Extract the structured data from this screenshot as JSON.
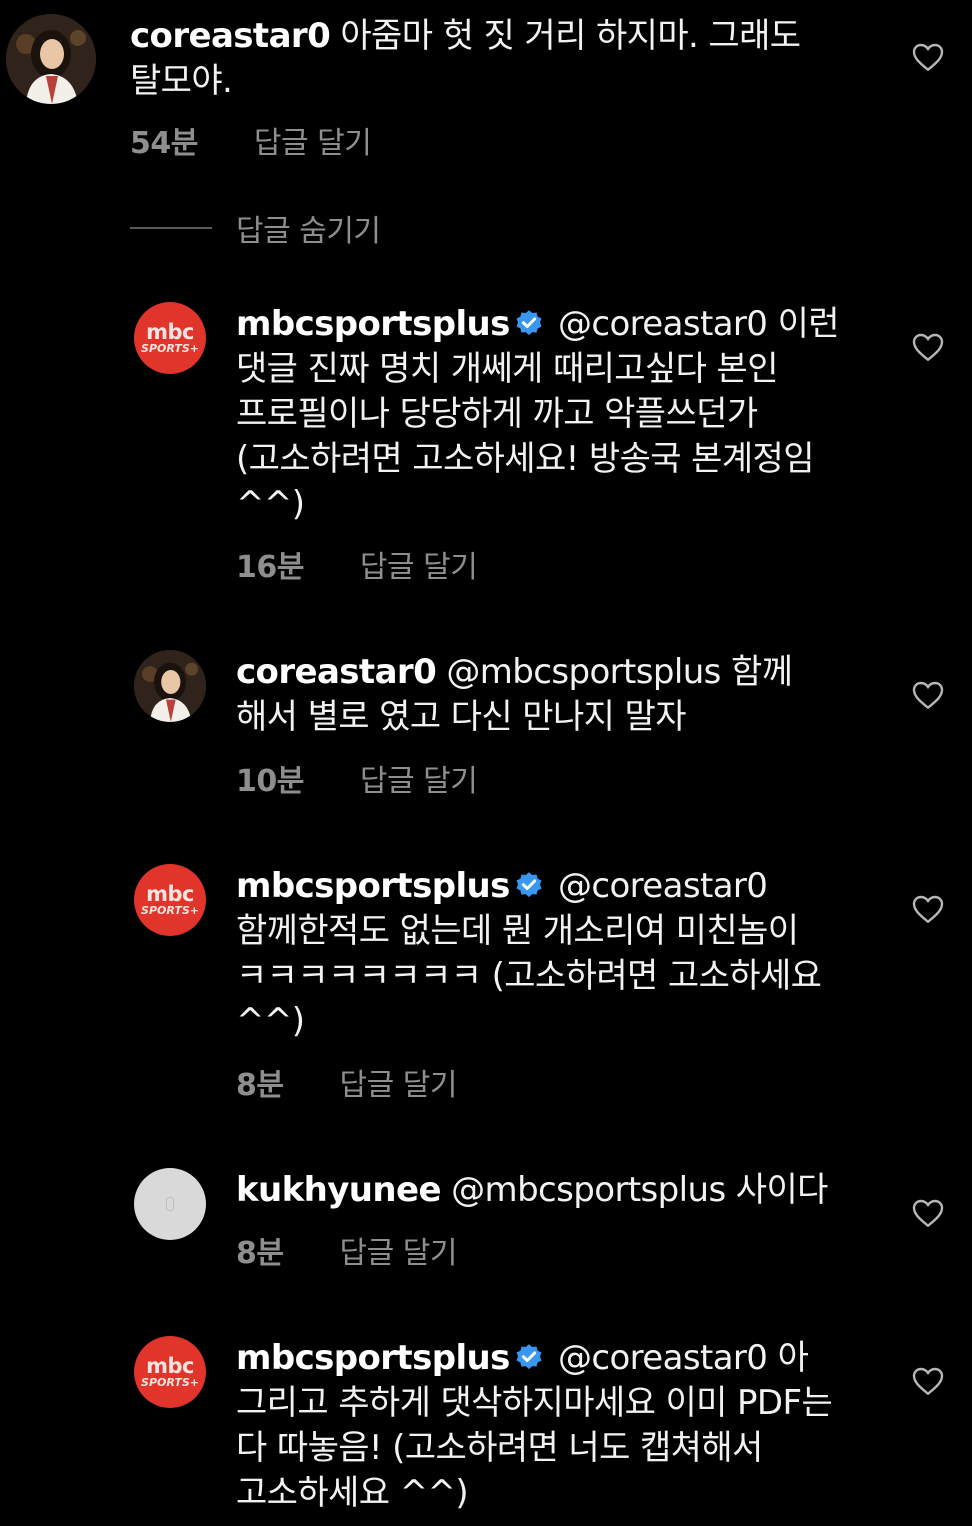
{
  "comments": [
    {
      "username": "coreastar0",
      "verified": false,
      "mention": "",
      "text": "아줌마 헛 짓 거리 하지마. 그래도 탈모야.",
      "time": "54분",
      "reply_label": "답글 달기",
      "avatar": "profile-photo"
    },
    {
      "username": "mbcsportsplus",
      "verified": true,
      "mention": "@coreastar0",
      "text": "이런 댓글 진짜 명치 개쎄게 때리고싶다 본인 프로필이나 당당하게 까고 악플쓰던가 (고소하려면 고소하세요! 방송국 본계정임 ^^)",
      "time": "16분",
      "reply_label": "답글 달기",
      "avatar": "mbc-sports-logo"
    },
    {
      "username": "coreastar0",
      "verified": false,
      "mention": "@mbcsportsplus",
      "text": "함께 해서 별로 였고 다신 만나지 말자",
      "time": "10분",
      "reply_label": "답글 달기",
      "avatar": "profile-photo"
    },
    {
      "username": "mbcsportsplus",
      "verified": true,
      "mention": "@coreastar0",
      "text": "함께한적도 없는데 뭔 개소리여 미친놈이 ㅋㅋㅋㅋㅋㅋㅋㅋ (고소하려면 고소하세요 ^^)",
      "time": "8분",
      "reply_label": "답글 달기",
      "avatar": "mbc-sports-logo"
    },
    {
      "username": "kukhyunee",
      "verified": false,
      "mention": "@mbcsportsplus",
      "text": "사이다",
      "time": "8분",
      "reply_label": "답글 달기",
      "avatar": "default-avatar"
    },
    {
      "username": "mbcsportsplus",
      "verified": true,
      "mention": "@coreastar0",
      "text": "아 그리고 추하게 댓삭하지마세요 이미 PDF는 다 따놓음! (고소하려면 너도 캡쳐해서 고소하세요 ^^)",
      "time": "",
      "reply_label": "",
      "avatar": "mbc-sports-logo"
    }
  ],
  "hide_replies_label": "답글 숨기기",
  "mbc_logo_text": {
    "top": "mbc",
    "bottom": "SPORTS+"
  },
  "colors": {
    "background": "#000000",
    "text": "#f2f2f2",
    "meta": "#8e8e8e",
    "verified": "#3897f0",
    "mbc_red": "#e1352b"
  },
  "icons": [
    "heart-icon",
    "verified-badge-icon"
  ]
}
